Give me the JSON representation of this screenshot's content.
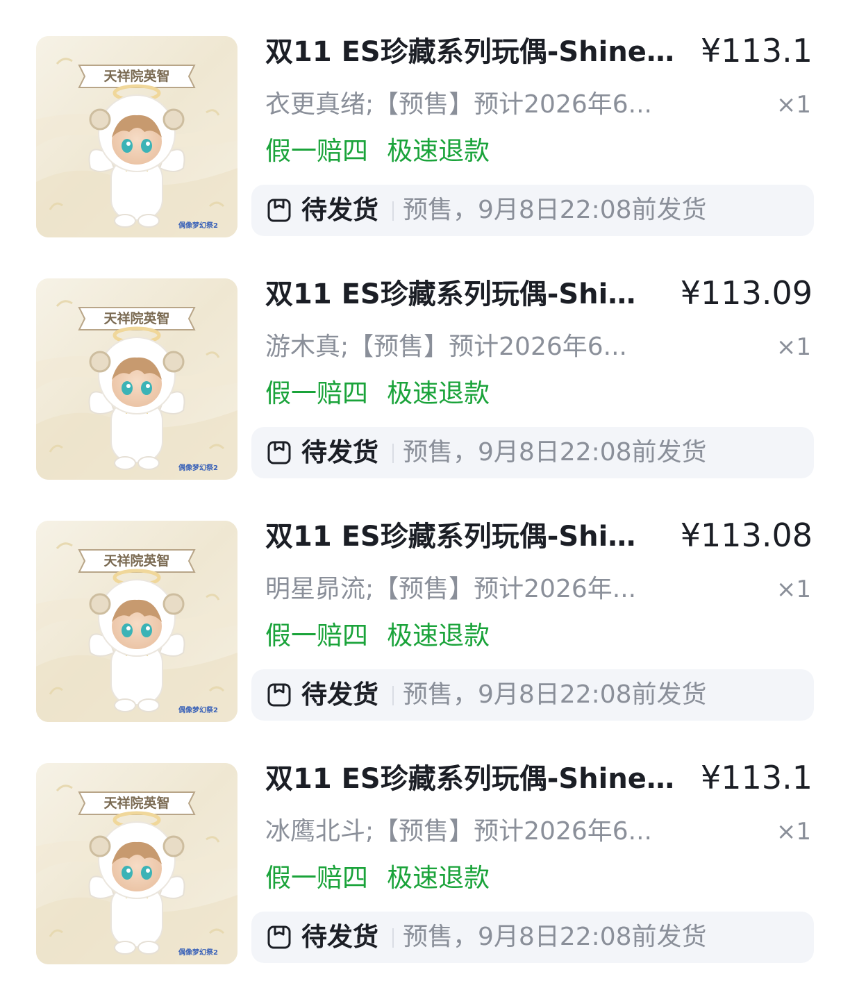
{
  "colors": {
    "tag_green": "#1aa33a",
    "muted_text": "#8a8f99",
    "status_bg": "#f3f5f9"
  },
  "orders": [
    {
      "image_banner": "天祥院英智",
      "image_logo": "偶像梦幻祭2",
      "title": "双11 ES珍藏系列玩偶-Shine ...",
      "price": "¥113.1",
      "spec": "衣更真绪;【预售】预计2026年6...",
      "qty": "×1",
      "tags": [
        "假一赔四",
        "极速退款"
      ],
      "status_icon": "package-icon",
      "status_label": "待发货",
      "status_note": "预售，9月8日22:08前发货"
    },
    {
      "image_banner": "天祥院英智",
      "image_logo": "偶像梦幻祭2",
      "title": "双11 ES珍藏系列玩偶-Shin...",
      "price": "¥113.09",
      "spec": "游木真;【预售】预计2026年6...",
      "qty": "×1",
      "tags": [
        "假一赔四",
        "极速退款"
      ],
      "status_icon": "package-icon",
      "status_label": "待发货",
      "status_note": "预售，9月8日22:08前发货"
    },
    {
      "image_banner": "天祥院英智",
      "image_logo": "偶像梦幻祭2",
      "title": "双11 ES珍藏系列玩偶-Shin...",
      "price": "¥113.08",
      "spec": "明星昴流;【预售】预计2026年...",
      "qty": "×1",
      "tags": [
        "假一赔四",
        "极速退款"
      ],
      "status_icon": "package-icon",
      "status_label": "待发货",
      "status_note": "预售，9月8日22:08前发货"
    },
    {
      "image_banner": "天祥院英智",
      "image_logo": "偶像梦幻祭2",
      "title": "双11 ES珍藏系列玩偶-Shine ...",
      "price": "¥113.1",
      "spec": "冰鹰北斗;【预售】预计2026年6...",
      "qty": "×1",
      "tags": [
        "假一赔四",
        "极速退款"
      ],
      "status_icon": "package-icon",
      "status_label": "待发货",
      "status_note": "预售，9月8日22:08前发货"
    }
  ]
}
